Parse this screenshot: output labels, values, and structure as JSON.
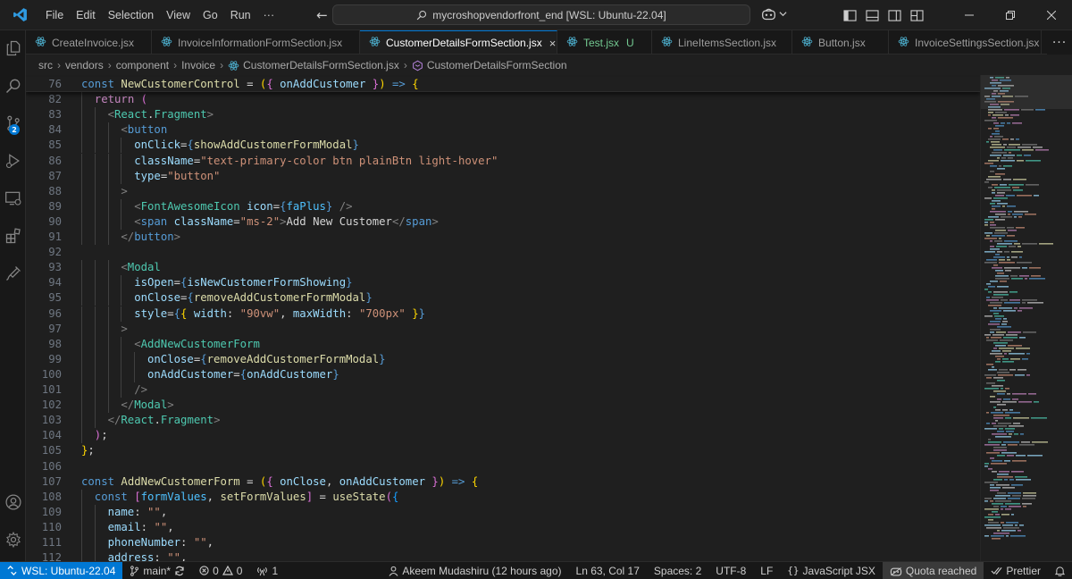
{
  "titlebar": {
    "menu": [
      "File",
      "Edit",
      "Selection",
      "View",
      "Go",
      "Run",
      "···"
    ],
    "command_center": "mycroshopvendorfront_end [WSL: Ubuntu-22.04]"
  },
  "activity_badge": "2",
  "tabs": [
    {
      "label": "CreateInvoice.jsx",
      "active": false
    },
    {
      "label": "InvoiceInformationFormSection.jsx",
      "active": false
    },
    {
      "label": "CustomerDetailsFormSection.jsx",
      "active": true
    },
    {
      "label": "Test.jsx",
      "active": false,
      "status": "U"
    },
    {
      "label": "LineItemsSection.jsx",
      "active": false
    },
    {
      "label": "Button.jsx",
      "active": false
    },
    {
      "label": "InvoiceSettingsSection.jsx",
      "active": false
    }
  ],
  "breadcrumb": [
    "src",
    "vendors",
    "component",
    "Invoice",
    "CustomerDetailsFormSection.jsx",
    "CustomerDetailsFormSection"
  ],
  "editor": {
    "lines": [
      {
        "n": "76",
        "sticky": true,
        "indent": 0,
        "toks": [
          [
            "k",
            "const "
          ],
          [
            "f",
            "NewCustomerControl"
          ],
          [
            "p",
            " = "
          ],
          [
            "b1",
            "("
          ],
          [
            "b2",
            "{"
          ],
          [
            "v",
            " onAddCustomer "
          ],
          [
            "b2",
            "}"
          ],
          [
            "b1",
            ")"
          ],
          [
            "k",
            " =>"
          ],
          [
            "p",
            " "
          ],
          [
            "b1",
            "{"
          ]
        ]
      },
      {
        "n": "82",
        "indent": 1,
        "toks": [
          [
            "kc",
            "return"
          ],
          [
            "p",
            " "
          ],
          [
            "b2",
            "("
          ]
        ]
      },
      {
        "n": "83",
        "indent": 2,
        "toks": [
          [
            "tg",
            "<"
          ],
          [
            "t",
            "React"
          ],
          [
            "p",
            "."
          ],
          [
            "t",
            "Fragment"
          ],
          [
            "tg",
            ">"
          ]
        ]
      },
      {
        "n": "84",
        "indent": 3,
        "toks": [
          [
            "tg",
            "<"
          ],
          [
            "k",
            "button"
          ]
        ]
      },
      {
        "n": "85",
        "indent": 4,
        "toks": [
          [
            "v",
            "onClick"
          ],
          [
            "p",
            "="
          ],
          [
            "k",
            "{"
          ],
          [
            "f",
            "showAddCustomerFormModal"
          ],
          [
            "k",
            "}"
          ]
        ]
      },
      {
        "n": "86",
        "indent": 4,
        "toks": [
          [
            "v",
            "className"
          ],
          [
            "p",
            "="
          ],
          [
            "s",
            "\"text-primary-color btn plainBtn light-hover\""
          ]
        ]
      },
      {
        "n": "87",
        "indent": 4,
        "toks": [
          [
            "v",
            "type"
          ],
          [
            "p",
            "="
          ],
          [
            "s",
            "\"button\""
          ]
        ]
      },
      {
        "n": "88",
        "indent": 3,
        "toks": [
          [
            "tg",
            ">"
          ]
        ]
      },
      {
        "n": "89",
        "indent": 4,
        "toks": [
          [
            "tg",
            "<"
          ],
          [
            "t",
            "FontAwesomeIcon"
          ],
          [
            "p",
            " "
          ],
          [
            "v",
            "icon"
          ],
          [
            "p",
            "="
          ],
          [
            "k",
            "{"
          ],
          [
            "c",
            "faPlus"
          ],
          [
            "k",
            "}"
          ],
          [
            "p",
            " "
          ],
          [
            "tg",
            "/>"
          ]
        ]
      },
      {
        "n": "90",
        "indent": 4,
        "toks": [
          [
            "tg",
            "<"
          ],
          [
            "k",
            "span"
          ],
          [
            "p",
            " "
          ],
          [
            "v",
            "className"
          ],
          [
            "p",
            "="
          ],
          [
            "s",
            "\"ms-2\""
          ],
          [
            "tg",
            ">"
          ],
          [
            "p",
            "Add New Customer"
          ],
          [
            "tg",
            "</"
          ],
          [
            "k",
            "span"
          ],
          [
            "tg",
            ">"
          ]
        ]
      },
      {
        "n": "91",
        "indent": 3,
        "toks": [
          [
            "tg",
            "</"
          ],
          [
            "k",
            "button"
          ],
          [
            "tg",
            ">"
          ]
        ]
      },
      {
        "n": "92",
        "indent": 0,
        "toks": []
      },
      {
        "n": "93",
        "indent": 3,
        "toks": [
          [
            "tg",
            "<"
          ],
          [
            "t",
            "Modal"
          ]
        ]
      },
      {
        "n": "94",
        "indent": 4,
        "toks": [
          [
            "v",
            "isOpen"
          ],
          [
            "p",
            "="
          ],
          [
            "k",
            "{"
          ],
          [
            "v",
            "isNewCustomerFormShowing"
          ],
          [
            "k",
            "}"
          ]
        ]
      },
      {
        "n": "95",
        "indent": 4,
        "toks": [
          [
            "v",
            "onClose"
          ],
          [
            "p",
            "="
          ],
          [
            "k",
            "{"
          ],
          [
            "f",
            "removeAddCustomerFormModal"
          ],
          [
            "k",
            "}"
          ]
        ]
      },
      {
        "n": "96",
        "indent": 4,
        "toks": [
          [
            "v",
            "style"
          ],
          [
            "p",
            "="
          ],
          [
            "k",
            "{"
          ],
          [
            "b1",
            "{"
          ],
          [
            "v",
            " width"
          ],
          [
            "p",
            ": "
          ],
          [
            "s",
            "\"90vw\""
          ],
          [
            "p",
            ", "
          ],
          [
            "v",
            "maxWidth"
          ],
          [
            "p",
            ": "
          ],
          [
            "s",
            "\"700px\""
          ],
          [
            "p",
            " "
          ],
          [
            "b1",
            "}"
          ],
          [
            "k",
            "}"
          ]
        ]
      },
      {
        "n": "97",
        "indent": 3,
        "toks": [
          [
            "tg",
            ">"
          ]
        ]
      },
      {
        "n": "98",
        "indent": 4,
        "toks": [
          [
            "tg",
            "<"
          ],
          [
            "t",
            "AddNewCustomerForm"
          ]
        ]
      },
      {
        "n": "99",
        "indent": 5,
        "toks": [
          [
            "v",
            "onClose"
          ],
          [
            "p",
            "="
          ],
          [
            "k",
            "{"
          ],
          [
            "f",
            "removeAddCustomerFormModal"
          ],
          [
            "k",
            "}"
          ]
        ]
      },
      {
        "n": "100",
        "indent": 5,
        "toks": [
          [
            "v",
            "onAddCustomer"
          ],
          [
            "p",
            "="
          ],
          [
            "k",
            "{"
          ],
          [
            "v",
            "onAddCustomer"
          ],
          [
            "k",
            "}"
          ]
        ]
      },
      {
        "n": "101",
        "indent": 4,
        "toks": [
          [
            "tg",
            "/>"
          ]
        ]
      },
      {
        "n": "102",
        "indent": 3,
        "toks": [
          [
            "tg",
            "</"
          ],
          [
            "t",
            "Modal"
          ],
          [
            "tg",
            ">"
          ]
        ]
      },
      {
        "n": "103",
        "indent": 2,
        "toks": [
          [
            "tg",
            "</"
          ],
          [
            "t",
            "React"
          ],
          [
            "p",
            "."
          ],
          [
            "t",
            "Fragment"
          ],
          [
            "tg",
            ">"
          ]
        ]
      },
      {
        "n": "104",
        "indent": 1,
        "toks": [
          [
            "b2",
            ")"
          ],
          [
            "p",
            ";"
          ]
        ]
      },
      {
        "n": "105",
        "indent": 0,
        "toks": [
          [
            "b1",
            "}"
          ],
          [
            "p",
            ";"
          ]
        ]
      },
      {
        "n": "106",
        "indent": 0,
        "toks": []
      },
      {
        "n": "107",
        "indent": 0,
        "toks": [
          [
            "k",
            "const "
          ],
          [
            "f",
            "AddNewCustomerForm"
          ],
          [
            "p",
            " = "
          ],
          [
            "b1",
            "("
          ],
          [
            "b2",
            "{"
          ],
          [
            "v",
            " onClose"
          ],
          [
            "p",
            ", "
          ],
          [
            "v",
            "onAddCustomer "
          ],
          [
            "b2",
            "}"
          ],
          [
            "b1",
            ")"
          ],
          [
            "k",
            " =>"
          ],
          [
            "p",
            " "
          ],
          [
            "b1",
            "{"
          ]
        ]
      },
      {
        "n": "108",
        "indent": 1,
        "toks": [
          [
            "k",
            "const "
          ],
          [
            "b2",
            "["
          ],
          [
            "c",
            "formValues"
          ],
          [
            "p",
            ", "
          ],
          [
            "f",
            "setFormValues"
          ],
          [
            "b2",
            "]"
          ],
          [
            "p",
            " = "
          ],
          [
            "f",
            "useState"
          ],
          [
            "b2",
            "("
          ],
          [
            "b3",
            "{"
          ]
        ]
      },
      {
        "n": "109",
        "indent": 2,
        "toks": [
          [
            "v",
            "name"
          ],
          [
            "p",
            ": "
          ],
          [
            "s",
            "\"\""
          ],
          [
            "p",
            ","
          ]
        ]
      },
      {
        "n": "110",
        "indent": 2,
        "toks": [
          [
            "v",
            "email"
          ],
          [
            "p",
            ": "
          ],
          [
            "s",
            "\"\""
          ],
          [
            "p",
            ","
          ]
        ]
      },
      {
        "n": "111",
        "indent": 2,
        "toks": [
          [
            "v",
            "phoneNumber"
          ],
          [
            "p",
            ": "
          ],
          [
            "s",
            "\"\""
          ],
          [
            "p",
            ","
          ]
        ]
      },
      {
        "n": "112",
        "indent": 2,
        "toks": [
          [
            "v",
            "address"
          ],
          [
            "p",
            ": "
          ],
          [
            "s",
            "\"\""
          ],
          [
            "p",
            ","
          ]
        ]
      }
    ]
  },
  "statusbar": {
    "remote": "WSL: Ubuntu-22.04",
    "branch": "main*",
    "errors": "0",
    "warnings": "0",
    "ports": "1",
    "blame": "Akeem Mudashiru (12 hours ago)",
    "cursor": "Ln 63, Col 17",
    "spaces": "Spaces: 2",
    "encoding": "UTF-8",
    "eol": "LF",
    "language": "JavaScript JSX",
    "quota": "Quota reached",
    "prettier": "Prettier"
  },
  "colors": {
    "accent": "#0078d4",
    "editor_bg": "#1f1f1f",
    "sidebar_bg": "#181818",
    "untracked": "#73c991"
  }
}
